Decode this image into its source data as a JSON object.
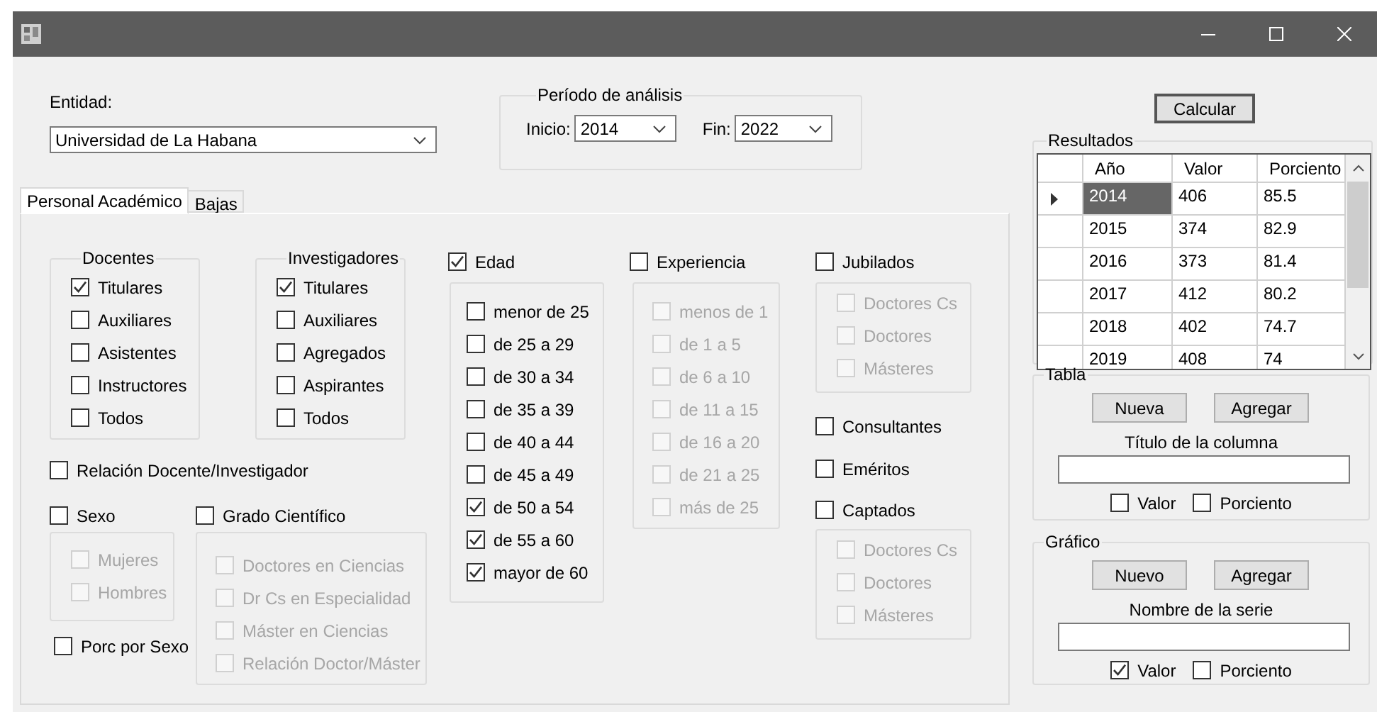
{
  "entidad": {
    "label": "Entidad:",
    "value": "Universidad de La Habana"
  },
  "periodo": {
    "title": "Período de análisis",
    "inicio": {
      "label": "Inicio:",
      "value": "2014"
    },
    "fin": {
      "label": "Fin:",
      "value": "2022"
    }
  },
  "tabs": [
    {
      "label": "Personal Académico",
      "selected": true
    },
    {
      "label": "Bajas",
      "selected": false
    }
  ],
  "docentes": {
    "title": "Docentes",
    "items": [
      {
        "label": "Titulares",
        "checked": true
      },
      {
        "label": "Auxiliares",
        "checked": false
      },
      {
        "label": "Asistentes",
        "checked": false
      },
      {
        "label": "Instructores",
        "checked": false
      },
      {
        "label": "Todos",
        "checked": false
      }
    ]
  },
  "investigadores": {
    "title": "Investigadores",
    "items": [
      {
        "label": "Titulares",
        "checked": true
      },
      {
        "label": "Auxiliares",
        "checked": false
      },
      {
        "label": "Agregados",
        "checked": false
      },
      {
        "label": "Aspirantes",
        "checked": false
      },
      {
        "label": "Todos",
        "checked": false
      }
    ]
  },
  "relacion": {
    "label": "Relación Docente/Investigador",
    "checked": false
  },
  "sexo": {
    "label": "Sexo",
    "checked": false,
    "items": [
      {
        "label": "Mujeres",
        "checked": false,
        "disabled": true
      },
      {
        "label": "Hombres",
        "checked": false,
        "disabled": true
      }
    ]
  },
  "porc_por_sexo": {
    "label": "Porc por Sexo",
    "checked": false
  },
  "grado": {
    "label": "Grado Científico",
    "checked": false,
    "items": [
      {
        "label": "Doctores en Ciencias",
        "checked": false,
        "disabled": true
      },
      {
        "label": "Dr Cs en Especialidad",
        "checked": false,
        "disabled": true
      },
      {
        "label": "Máster en Ciencias",
        "checked": false,
        "disabled": true
      },
      {
        "label": "Relación Doctor/Máster",
        "checked": false,
        "disabled": true
      }
    ]
  },
  "edad": {
    "label": "Edad",
    "checked": true,
    "items": [
      {
        "label": "menor de 25",
        "checked": false,
        "disabled": false
      },
      {
        "label": "de 25 a 29",
        "checked": false,
        "disabled": false
      },
      {
        "label": "de 30 a 34",
        "checked": false,
        "disabled": false
      },
      {
        "label": "de 35 a 39",
        "checked": false,
        "disabled": false
      },
      {
        "label": "de 40 a 44",
        "checked": false,
        "disabled": false
      },
      {
        "label": "de 45 a 49",
        "checked": false,
        "disabled": false
      },
      {
        "label": "de 50 a 54",
        "checked": true,
        "disabled": false
      },
      {
        "label": "de 55 a 60",
        "checked": true,
        "disabled": false
      },
      {
        "label": "mayor de 60",
        "checked": true,
        "disabled": false
      }
    ]
  },
  "experiencia": {
    "label": "Experiencia",
    "checked": false,
    "items": [
      {
        "label": "menos de 1",
        "checked": false,
        "disabled": true
      },
      {
        "label": "de 1 a 5",
        "checked": false,
        "disabled": true
      },
      {
        "label": "de 6 a 10",
        "checked": false,
        "disabled": true
      },
      {
        "label": "de 11 a 15",
        "checked": false,
        "disabled": true
      },
      {
        "label": "de 16 a 20",
        "checked": false,
        "disabled": true
      },
      {
        "label": "de 21 a 25",
        "checked": false,
        "disabled": true
      },
      {
        "label": "más de 25",
        "checked": false,
        "disabled": true
      }
    ]
  },
  "jubilados": {
    "label": "Jubilados",
    "checked": false,
    "items": [
      {
        "label": "Doctores Cs",
        "checked": false,
        "disabled": true
      },
      {
        "label": "Doctores",
        "checked": false,
        "disabled": true
      },
      {
        "label": "Másteres",
        "checked": false,
        "disabled": true
      }
    ]
  },
  "consultantes": {
    "label": "Consultantes",
    "checked": false
  },
  "emeritos": {
    "label": "Eméritos",
    "checked": false
  },
  "captados": {
    "label": "Captados",
    "checked": false,
    "items": [
      {
        "label": "Doctores Cs",
        "checked": false,
        "disabled": true
      },
      {
        "label": "Doctores",
        "checked": false,
        "disabled": true
      },
      {
        "label": "Másteres",
        "checked": false,
        "disabled": true
      }
    ]
  },
  "calcular_button": "Calcular",
  "resultados": {
    "title": "Resultados",
    "columns": [
      "Año",
      "Valor",
      "Porciento"
    ],
    "rows": [
      {
        "cells": [
          "2014",
          "406",
          "85.5"
        ],
        "selected": true
      },
      {
        "cells": [
          "2015",
          "374",
          "82.9"
        ],
        "selected": false
      },
      {
        "cells": [
          "2016",
          "373",
          "81.4"
        ],
        "selected": false
      },
      {
        "cells": [
          "2017",
          "412",
          "80.2"
        ],
        "selected": false
      },
      {
        "cells": [
          "2018",
          "402",
          "74.7"
        ],
        "selected": false
      },
      {
        "cells": [
          "2019",
          "408",
          "74"
        ],
        "selected": false
      }
    ]
  },
  "tabla": {
    "title": "Tabla",
    "buttons": [
      "Nueva",
      "Agregar"
    ],
    "field_label": "Título de la columna",
    "checks": [
      {
        "label": "Valor",
        "checked": false
      },
      {
        "label": "Porciento",
        "checked": false
      }
    ]
  },
  "grafico": {
    "title": "Gráfico",
    "buttons": [
      "Nuevo",
      "Agregar"
    ],
    "field_label": "Nombre de la serie",
    "checks": [
      {
        "label": "Valor",
        "checked": true
      },
      {
        "label": "Porciento",
        "checked": false
      }
    ]
  }
}
